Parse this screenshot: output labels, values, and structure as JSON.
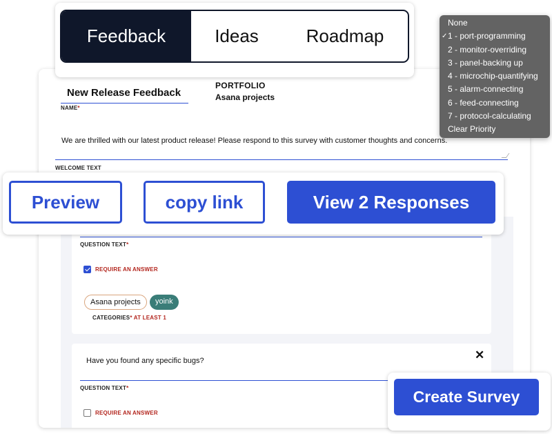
{
  "tabs": [
    {
      "label": "Feedback",
      "active": true
    },
    {
      "label": "Ideas",
      "active": false
    },
    {
      "label": "Roadmap",
      "active": false
    }
  ],
  "priority_dropdown": {
    "items": [
      {
        "label": "None",
        "selected": false
      },
      {
        "label": "1 - port-programming",
        "selected": true
      },
      {
        "label": "2 - monitor-overriding",
        "selected": false
      },
      {
        "label": "3 - panel-backing up",
        "selected": false
      },
      {
        "label": "4 - microchip-quantifying",
        "selected": false
      },
      {
        "label": "5 - alarm-connecting",
        "selected": false
      },
      {
        "label": "6 - feed-connecting",
        "selected": false
      },
      {
        "label": "7 - protocol-calculating",
        "selected": false
      },
      {
        "label": "Clear Priority",
        "selected": false
      }
    ],
    "check_glyph": "✓"
  },
  "form": {
    "name_value": "New Release Feedback",
    "name_label": "NAME",
    "required_mark": "*",
    "portfolio_label": "PORTFOLIO",
    "portfolio_value": "Asana projects",
    "welcome_value": "We are thrilled with our latest product release! Please respond to this survey with customer thoughts and concerns.",
    "welcome_label": "WELCOME TEXT"
  },
  "actions": {
    "preview": "Preview",
    "copy_link": "copy link",
    "view_responses": "View 2 Responses"
  },
  "questions": [
    {
      "text": "",
      "text_label": "QUESTION TEXT",
      "require_label": "REQUIRE AN ANSWER",
      "required": true,
      "categories": [
        "Asana projects",
        "yoink"
      ],
      "categories_label": "CATEGORIES",
      "categories_note": "AT LEAST 1"
    },
    {
      "text": "Have you found any specific bugs?",
      "text_label": "QUESTION TEXT",
      "require_label": "REQUIRE AN ANSWER",
      "required": false,
      "close_glyph": "✕"
    }
  ],
  "create_survey": "Create Survey",
  "colors": {
    "accent": "#2d4fd3",
    "tab_active_bg": "#0f172a",
    "dropdown_bg": "#636363",
    "required": "#b3261e",
    "chip_outline": "#d9a47c",
    "chip_filled": "#3a7d78"
  }
}
